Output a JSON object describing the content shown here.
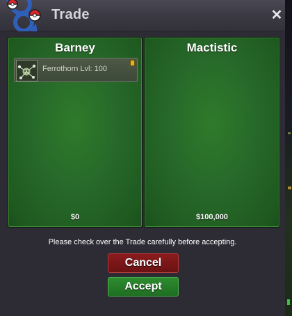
{
  "window": {
    "title": "Trade",
    "close_icon": "close-icon"
  },
  "panels": {
    "left": {
      "name": "Barney",
      "money": "$0",
      "items": [
        {
          "label": "Ferrothorn  Lvl: 100",
          "icon": "ferrothorn-sprite-icon"
        }
      ]
    },
    "right": {
      "name": "Mactistic",
      "money": "$100,000",
      "items": []
    }
  },
  "notice": "Please check over the Trade carefully before accepting.",
  "buttons": {
    "cancel_label": "Cancel",
    "accept_label": "Accept"
  },
  "colors": {
    "panel_green": "#27692a",
    "cancel_red": "#7a1618",
    "accept_green": "#2a8a2d"
  }
}
